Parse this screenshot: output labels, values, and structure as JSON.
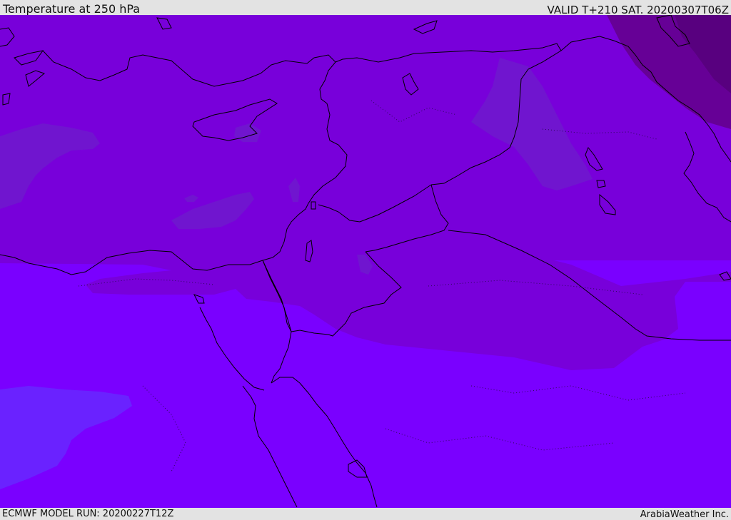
{
  "header": {
    "title": "Temperature at 250 hPa",
    "valid": "VALID T+210 SAT. 20200307T06Z"
  },
  "footer": {
    "model_run": "ECMWF MODEL RUN: 20200227T12Z",
    "credit": "ArabiaWeather Inc."
  },
  "map": {
    "field": "Temperature at 250 hPa",
    "colors": {
      "band_cold_north": "#7800da",
      "band_south": "#7a00ff",
      "patch_warm": "#7015cf",
      "patch_deep": "#660096",
      "patch_darkest": "#58007f",
      "patch_bluish": "#6a22ff",
      "coastline": "#000000"
    }
  }
}
